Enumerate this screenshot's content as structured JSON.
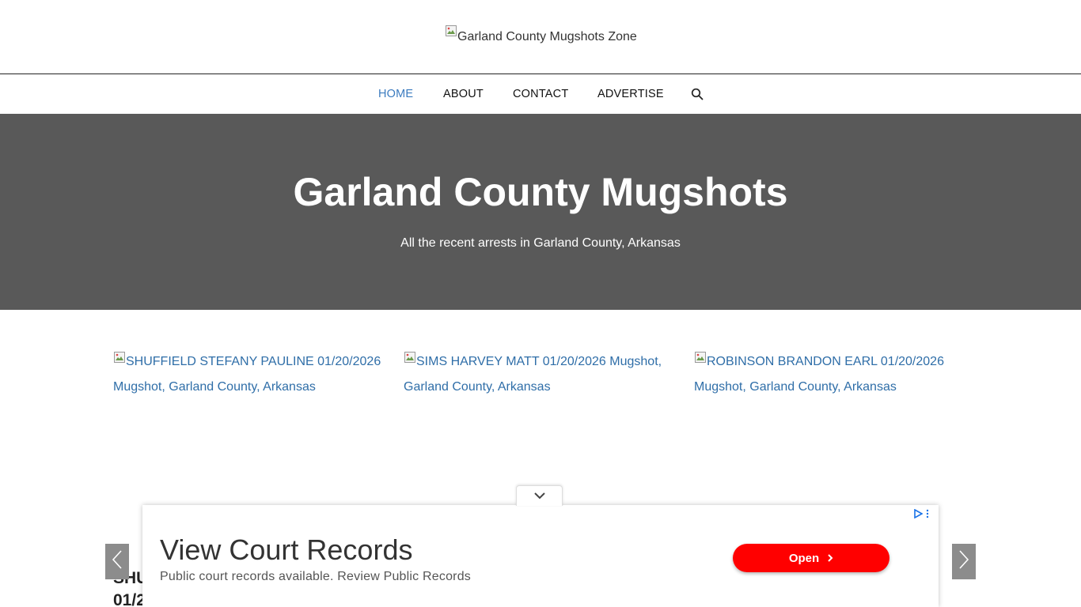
{
  "header": {
    "logo_alt": "Garland County Mugshots Zone"
  },
  "nav": {
    "items": [
      {
        "label": "HOME",
        "active": true
      },
      {
        "label": "ABOUT",
        "active": false
      },
      {
        "label": "CONTACT",
        "active": false
      },
      {
        "label": "ADVERTISE",
        "active": false
      }
    ],
    "search_icon": "search-icon"
  },
  "hero": {
    "title": "Garland County Mugshots",
    "subtitle": "All the recent arrests in Garland County, Arkansas"
  },
  "cards": [
    {
      "alt": "SHUFFIELD STEFANY PAULINE 01/20/2026 Mugshot, Garland County, Arkansas"
    },
    {
      "alt": "SIMS HARVEY MATT 01/20/2026 Mugshot, Garland County, Arkansas"
    },
    {
      "alt": "ROBINSON BRANDON EARL 01/20/2026 Mugshot, Garland County, Arkansas"
    }
  ],
  "slider": {
    "partial_title_line1": "SHU",
    "partial_title_line2": "01/2"
  },
  "ad": {
    "title": "View Court Records",
    "description": "Public court records available. Review Public Records",
    "button_label": "Open",
    "button_color": "#ff0000"
  },
  "colors": {
    "accent": "#3b7bbf",
    "hero_bg": "#595959",
    "link": "#2f6ea8"
  }
}
